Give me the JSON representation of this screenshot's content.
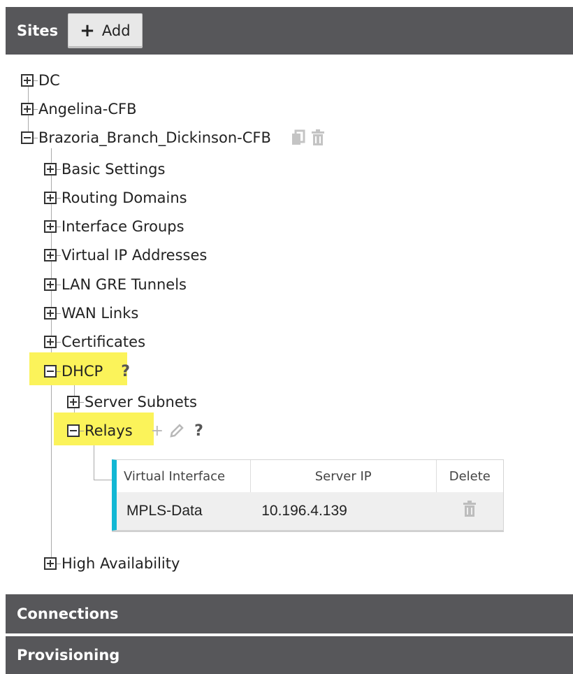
{
  "sites": {
    "title": "Sites",
    "add_label": "Add",
    "tree": {
      "dc": "DC",
      "angelina": "Angelina-CFB",
      "brazoria": "Brazoria_Branch_Dickinson-CFB",
      "children": {
        "basic": "Basic Settings",
        "routing": "Routing Domains",
        "ifgroups": "Interface Groups",
        "vip": "Virtual IP Addresses",
        "langre": "LAN GRE Tunnels",
        "wan": "WAN Links",
        "certs": "Certificates",
        "dhcp": "DHCP",
        "ha": "High Availability"
      },
      "dhcp_children": {
        "server_subnets": "Server Subnets",
        "relays": "Relays"
      },
      "help": "?"
    },
    "relay_table": {
      "headers": [
        "Virtual Interface",
        "Server IP",
        "Delete"
      ],
      "rows": [
        {
          "virtual_interface": "MPLS-Data",
          "server_ip": "10.196.4.139"
        }
      ]
    }
  },
  "connections": {
    "title": "Connections"
  },
  "provisioning": {
    "title": "Provisioning"
  }
}
